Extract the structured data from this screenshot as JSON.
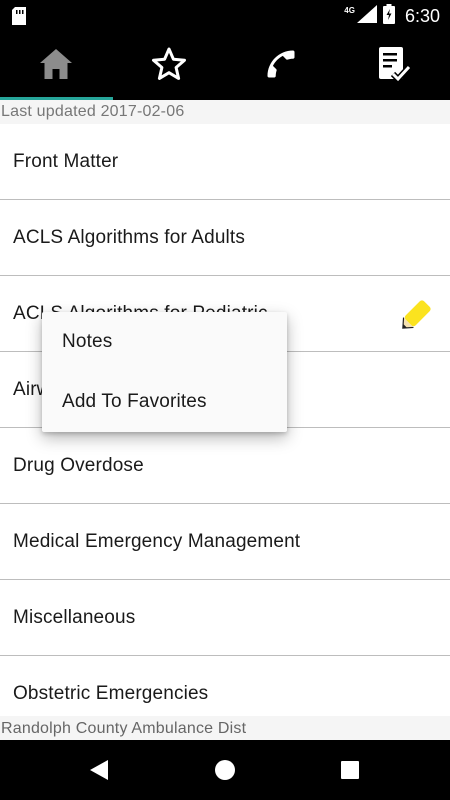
{
  "status_bar": {
    "network": "4G",
    "time": "6:30"
  },
  "tabs": [
    {
      "name": "home",
      "icon": "home-icon",
      "active": true
    },
    {
      "name": "favorites",
      "icon": "star-icon",
      "active": false
    },
    {
      "name": "contacts",
      "icon": "phone-icon",
      "active": false
    },
    {
      "name": "checklist",
      "icon": "checklist-icon",
      "active": false
    }
  ],
  "last_updated": "Last updated 2017-02-06",
  "list": {
    "items": [
      {
        "label": "Front Matter"
      },
      {
        "label": "ACLS Algorithms for Adults"
      },
      {
        "label": "ACLS Algorithms for Pediatric",
        "has_note": true,
        "note_icon": "pencil-icon"
      },
      {
        "label": "Airway Management"
      },
      {
        "label": "Drug Overdose"
      },
      {
        "label": "Medical Emergency Management"
      },
      {
        "label": "Miscellaneous"
      },
      {
        "label": "Obstetric Emergencies"
      }
    ]
  },
  "context_menu": {
    "items": [
      {
        "label": "Notes"
      },
      {
        "label": "Add To Favorites"
      }
    ]
  },
  "footer": "Randolph County Ambulance Dist",
  "colors": {
    "accent": "#26a69a",
    "pencil": "#fbe31f",
    "bars": "#000000"
  }
}
